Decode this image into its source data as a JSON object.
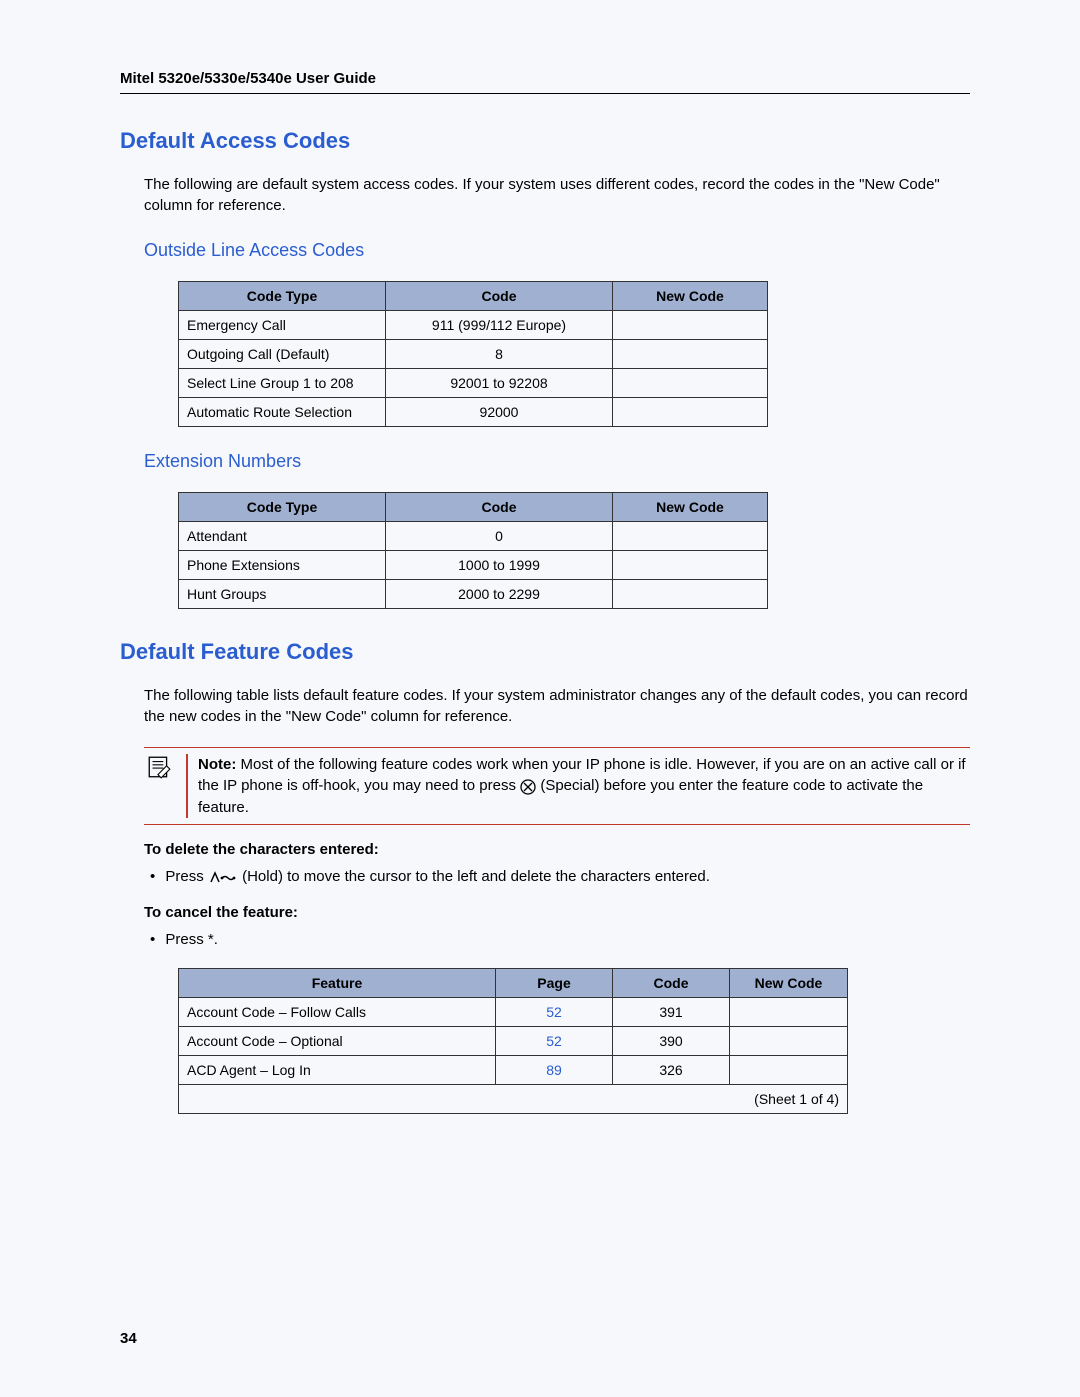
{
  "header": "Mitel 5320e/5330e/5340e User Guide",
  "sectionA": {
    "title": "Default Access Codes",
    "intro": "The following are default system access codes. If your system uses different codes, record the codes in the \"New Code\" column for reference.",
    "table1": {
      "title": "Outside Line Access Codes",
      "headers": [
        "Code Type",
        "Code",
        "New Code"
      ],
      "rows": [
        {
          "type": "Emergency Call",
          "code": "911 (999/112 Europe)",
          "new": ""
        },
        {
          "type": "Outgoing Call (Default)",
          "code": "8",
          "new": ""
        },
        {
          "type": "Select Line Group 1 to 208",
          "code": "92001 to 92208",
          "new": ""
        },
        {
          "type": "Automatic Route Selection",
          "code": "92000",
          "new": ""
        }
      ]
    },
    "table2": {
      "title": "Extension Numbers",
      "headers": [
        "Code Type",
        "Code",
        "New Code"
      ],
      "rows": [
        {
          "type": "Attendant",
          "code": "0",
          "new": ""
        },
        {
          "type": "Phone Extensions",
          "code": "1000 to 1999",
          "new": ""
        },
        {
          "type": "Hunt Groups",
          "code": "2000 to 2299",
          "new": ""
        }
      ]
    }
  },
  "sectionB": {
    "title": "Default Feature Codes",
    "intro": "The following table lists default feature codes. If your system administrator changes any of the default codes, you can record the new codes in the \"New Code\" column for reference.",
    "note": {
      "label": "Note:",
      "text1": " Most of the following feature codes work when your IP phone is idle. However, if you are on an active call or if the IP phone is off-hook, you may need to press ",
      "text2": " (Special) before you enter the feature code to activate the feature."
    },
    "instr1": {
      "heading": "To delete the characters entered:",
      "line_a": "Press  ",
      "line_b": " (Hold) to move the cursor to the left and delete the characters entered."
    },
    "instr2": {
      "heading": "To cancel the feature:",
      "line": "Press *."
    },
    "table": {
      "headers": [
        "Feature",
        "Page",
        "Code",
        "New Code"
      ],
      "rows": [
        {
          "feature": "Account Code – Follow Calls",
          "page": "52",
          "code": "391",
          "new": ""
        },
        {
          "feature": "Account Code – Optional",
          "page": "52",
          "code": "390",
          "new": ""
        },
        {
          "feature": "ACD Agent – Log In",
          "page": "89",
          "code": "326",
          "new": ""
        }
      ],
      "sheet": "(Sheet 1 of 4)"
    }
  },
  "pageNumber": "34"
}
